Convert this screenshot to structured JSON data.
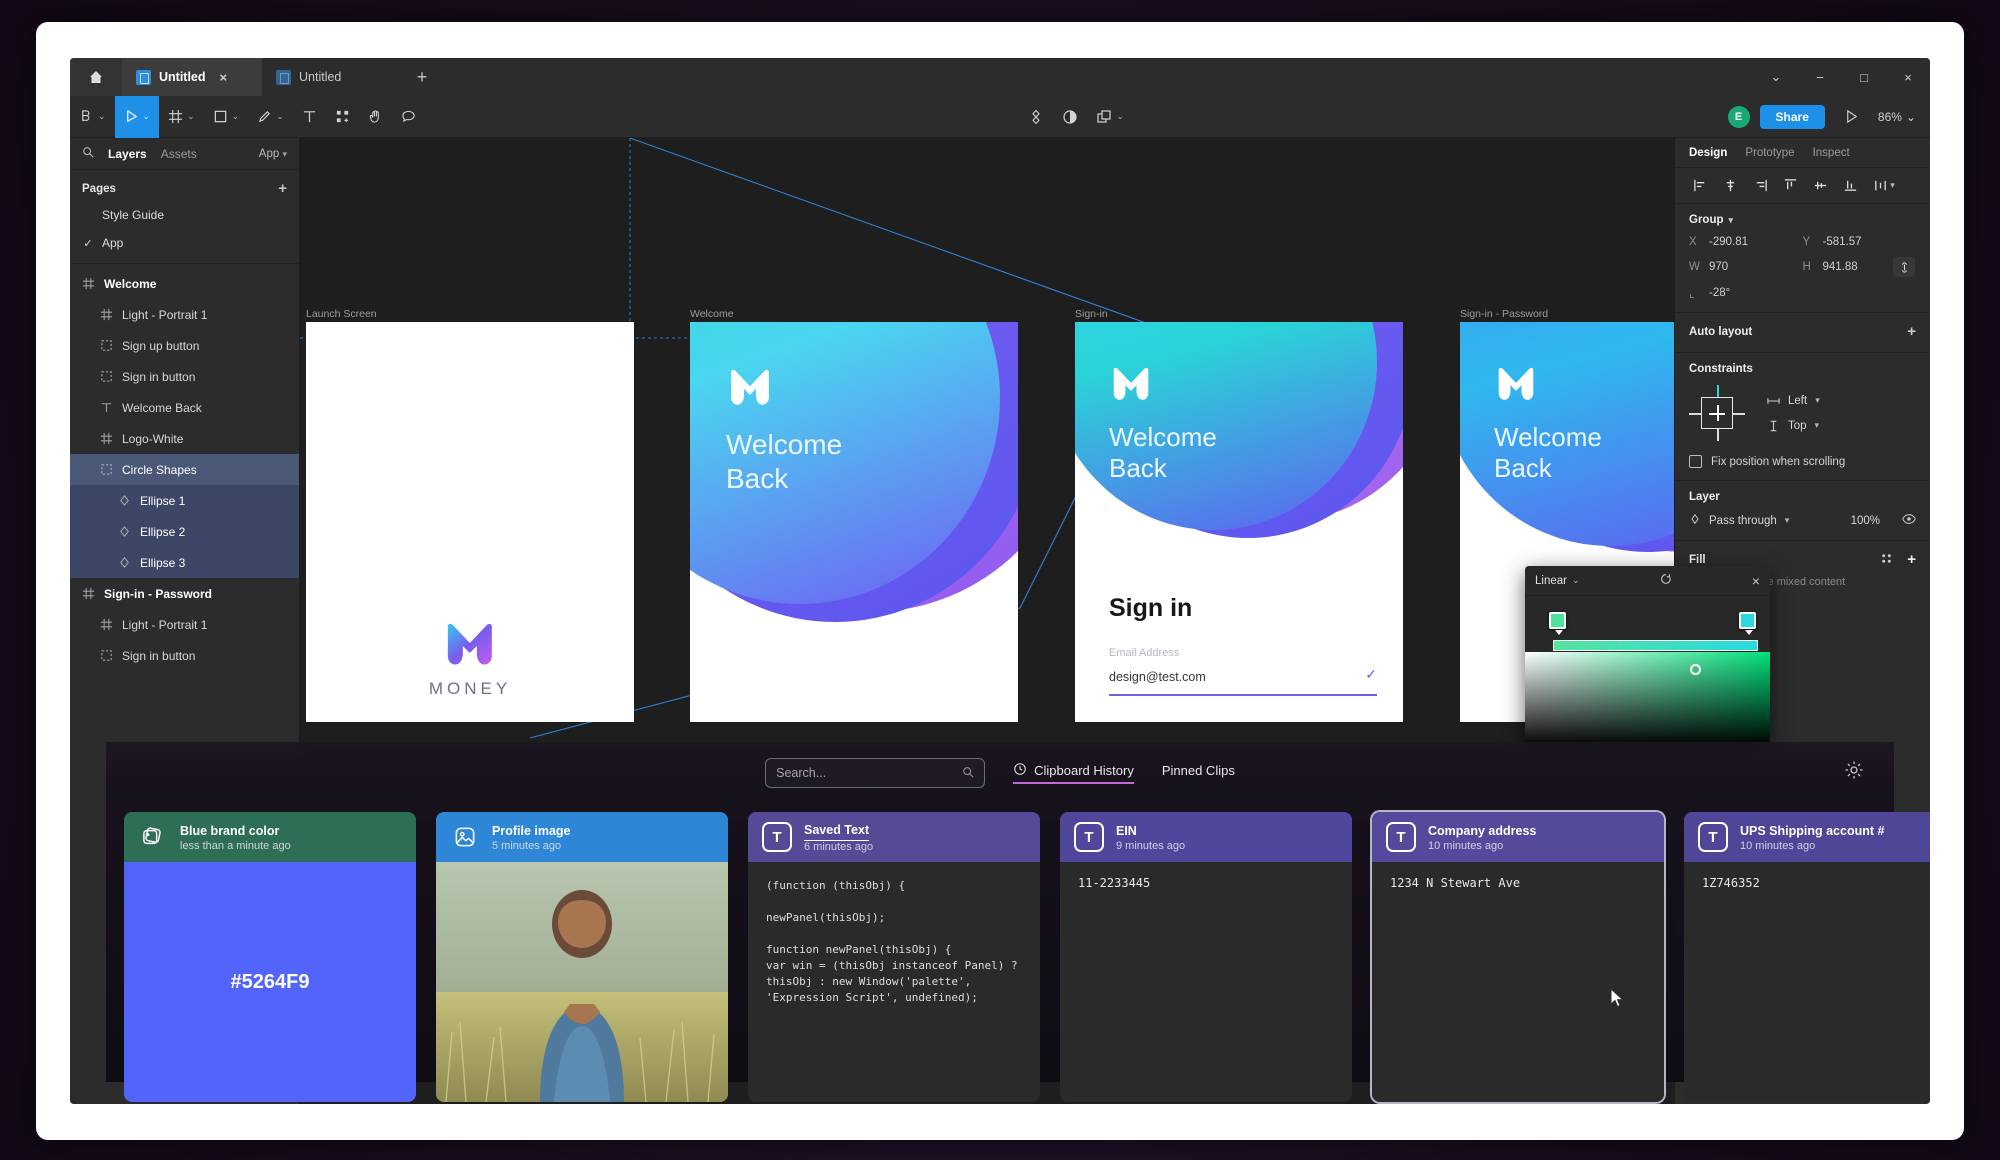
{
  "window": {
    "tabs": [
      {
        "label": "Untitled",
        "active": true,
        "close": "×"
      },
      {
        "label": "Untitled",
        "active": false,
        "close": ""
      }
    ],
    "new_tab": "+",
    "controls": {
      "chevron": "⌄",
      "minimize": "−",
      "maximize": "□",
      "close": "×"
    }
  },
  "toolbar": {
    "zoom_level": "86%",
    "share_label": "Share",
    "avatar_initial": "E",
    "caret": "⌄"
  },
  "left_panel": {
    "tabs": [
      {
        "label": "Layers",
        "active": true
      },
      {
        "label": "Assets",
        "active": false
      }
    ],
    "app_menu": "App",
    "pages_title": "Pages",
    "pages_add": "+",
    "pages": [
      {
        "label": "Style Guide",
        "checked": false
      },
      {
        "label": "App",
        "checked": true
      }
    ],
    "layers": [
      {
        "label": "Welcome",
        "depth": 0,
        "icon": "frame",
        "state": "bold"
      },
      {
        "label": "Light - Portrait 1",
        "depth": 1,
        "icon": "frame",
        "state": ""
      },
      {
        "label": "Sign up button",
        "depth": 1,
        "icon": "group",
        "state": ""
      },
      {
        "label": "Sign in button",
        "depth": 1,
        "icon": "group",
        "state": ""
      },
      {
        "label": "Welcome Back",
        "depth": 1,
        "icon": "text",
        "state": ""
      },
      {
        "label": "Logo-White",
        "depth": 1,
        "icon": "frame",
        "state": ""
      },
      {
        "label": "Circle Shapes",
        "depth": 1,
        "icon": "group",
        "state": "sel"
      },
      {
        "label": "Ellipse 1",
        "depth": 2,
        "icon": "ellipse",
        "state": "sel2"
      },
      {
        "label": "Ellipse 2",
        "depth": 2,
        "icon": "ellipse",
        "state": "sel2"
      },
      {
        "label": "Ellipse 3",
        "depth": 2,
        "icon": "ellipse",
        "state": "sel2"
      },
      {
        "label": "Sign-in - Password",
        "depth": 0,
        "icon": "frame",
        "state": "bold"
      },
      {
        "label": "Light - Portrait 1",
        "depth": 1,
        "icon": "frame",
        "state": ""
      },
      {
        "label": "Sign in button",
        "depth": 1,
        "icon": "group",
        "state": ""
      }
    ]
  },
  "canvas": {
    "frames": [
      {
        "label": "Launch Screen"
      },
      {
        "label": "Welcome"
      },
      {
        "label": "Sign-in"
      },
      {
        "label": "Sign-in - Password"
      }
    ],
    "launch": {
      "wordmark": "MONEY"
    },
    "welcome_text_line1": "Welcome",
    "welcome_text_line2": "Back",
    "signin": {
      "heading": "Sign in",
      "email_label": "Email Address",
      "email_value": "design@test.com",
      "check": "✓"
    }
  },
  "gradient_popup": {
    "type": "Linear",
    "caret": "⌄",
    "close": "×",
    "stop_start_color": "#4ee39b",
    "stop_end_color": "#2ad9e0"
  },
  "right_panel": {
    "tabs": [
      {
        "label": "Design",
        "active": true
      },
      {
        "label": "Prototype",
        "active": false
      },
      {
        "label": "Inspect",
        "active": false
      }
    ],
    "group": {
      "title": "Group",
      "x_label": "X",
      "x_value": "-290.81",
      "y_label": "Y",
      "y_value": "-581.57",
      "w_label": "W",
      "w_value": "970",
      "h_label": "H",
      "h_value": "941.88",
      "rotation_label": "⌞",
      "rotation_value": "-28°"
    },
    "auto_layout": {
      "title": "Auto layout",
      "add": "+"
    },
    "constraints": {
      "title": "Constraints",
      "horizontal": "Left",
      "vertical": "Top",
      "fix_position": "Fix position when scrolling"
    },
    "layer": {
      "title": "Layer",
      "blend_mode": "Pass through",
      "opacity": "100%"
    },
    "fill": {
      "title": "Fill",
      "note": "Click + to replace mixed content",
      "add": "+"
    }
  },
  "clipboard": {
    "search_placeholder": "Search...",
    "tabs": [
      {
        "label": "Clipboard History",
        "active": true
      },
      {
        "label": "Pinned Clips",
        "active": false
      }
    ],
    "cards": [
      {
        "title": "Blue brand color",
        "time": "less than a minute ago",
        "kind": "color",
        "header_color": "#2d6e55",
        "value": "#5264F9",
        "icon": "color-swatch-icon",
        "icon_glyph": "",
        "selected": false,
        "title_underline": false
      },
      {
        "title": "Profile image",
        "time": "5 minutes ago",
        "kind": "image",
        "header_color": "#2d86d6",
        "value": "",
        "icon": "image-icon",
        "icon_glyph": "",
        "selected": false,
        "title_underline": false
      },
      {
        "title": "Saved Text",
        "time": "6 minutes ago",
        "kind": "code",
        "header_color": "#554a96",
        "value": "(function (thisObj) {\n\nnewPanel(thisObj);\n\nfunction newPanel(thisObj) {\nvar win = (thisObj instanceof Panel) ?\nthisObj : new Window('palette',\n'Expression Script', undefined);",
        "icon": "text-icon",
        "icon_glyph": "T",
        "selected": false,
        "title_underline": true
      },
      {
        "title": "EIN",
        "time": "9 minutes ago",
        "kind": "text",
        "header_color": "#4f479b",
        "value": "11-2233445",
        "icon": "text-icon",
        "icon_glyph": "T",
        "selected": false,
        "title_underline": false
      },
      {
        "title": "Company address",
        "time": "10 minutes ago",
        "kind": "text",
        "header_color": "#534a9c",
        "value": "1234 N Stewart Ave",
        "icon": "text-icon",
        "icon_glyph": "T",
        "selected": true,
        "title_underline": false
      },
      {
        "title": "UPS Shipping account #",
        "time": "10 minutes ago",
        "kind": "text",
        "header_color": "#4e4697",
        "value": "1Z746352",
        "icon": "text-icon",
        "icon_glyph": "T",
        "selected": false,
        "title_underline": false
      }
    ]
  }
}
